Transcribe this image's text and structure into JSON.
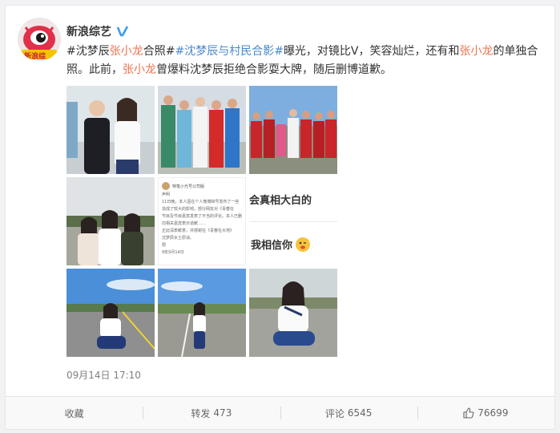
{
  "post": {
    "author": "新浪综艺",
    "avatar_badge": "新浪综",
    "content_parts": [
      {
        "type": "text",
        "text": "#沈梦辰"
      },
      {
        "type": "tag",
        "text": "张小龙"
      },
      {
        "type": "text",
        "text": "合照#"
      },
      {
        "type": "link",
        "text": "#沈梦辰与村民合影#"
      },
      {
        "type": "text",
        "text": "曝光，对镜比V，笑容灿烂，还有和"
      },
      {
        "type": "tag",
        "text": "张小龙"
      },
      {
        "type": "text",
        "text": "的单独合照。此前，"
      },
      {
        "type": "tag",
        "text": "张小龙"
      },
      {
        "type": "text",
        "text": "曾爆料沈梦辰拒绝合影耍大牌，随后删博道歉。"
      }
    ],
    "time": "09月14日 17:10",
    "screenshot_text": {
      "line1": "会真相大白的",
      "line2": "我相信你",
      "doc_lines": [
        "特笔小光号公司版",
        "声明",
        "11日晚，本人因在个人微博和号发布了一些",
        "造成了较大的影响，部分网友对《青春在",
        "节目及节目嘉宾发表了不当的评论。本人已删",
        "向相关嘉宾表示道歉……",
        "正此深表歉意，并感谢在《青春在大地》",
        "沈梦辰女士原谅。",
        "限",
        "9年9月14日"
      ]
    }
  },
  "actions": {
    "collect": "收藏",
    "repost_label": "转发",
    "repost_count": "473",
    "comment_label": "评论",
    "comment_count": "6545",
    "like_count": "76699"
  },
  "colors": {
    "tag": "#eb7350",
    "link": "#4a8ac9"
  }
}
